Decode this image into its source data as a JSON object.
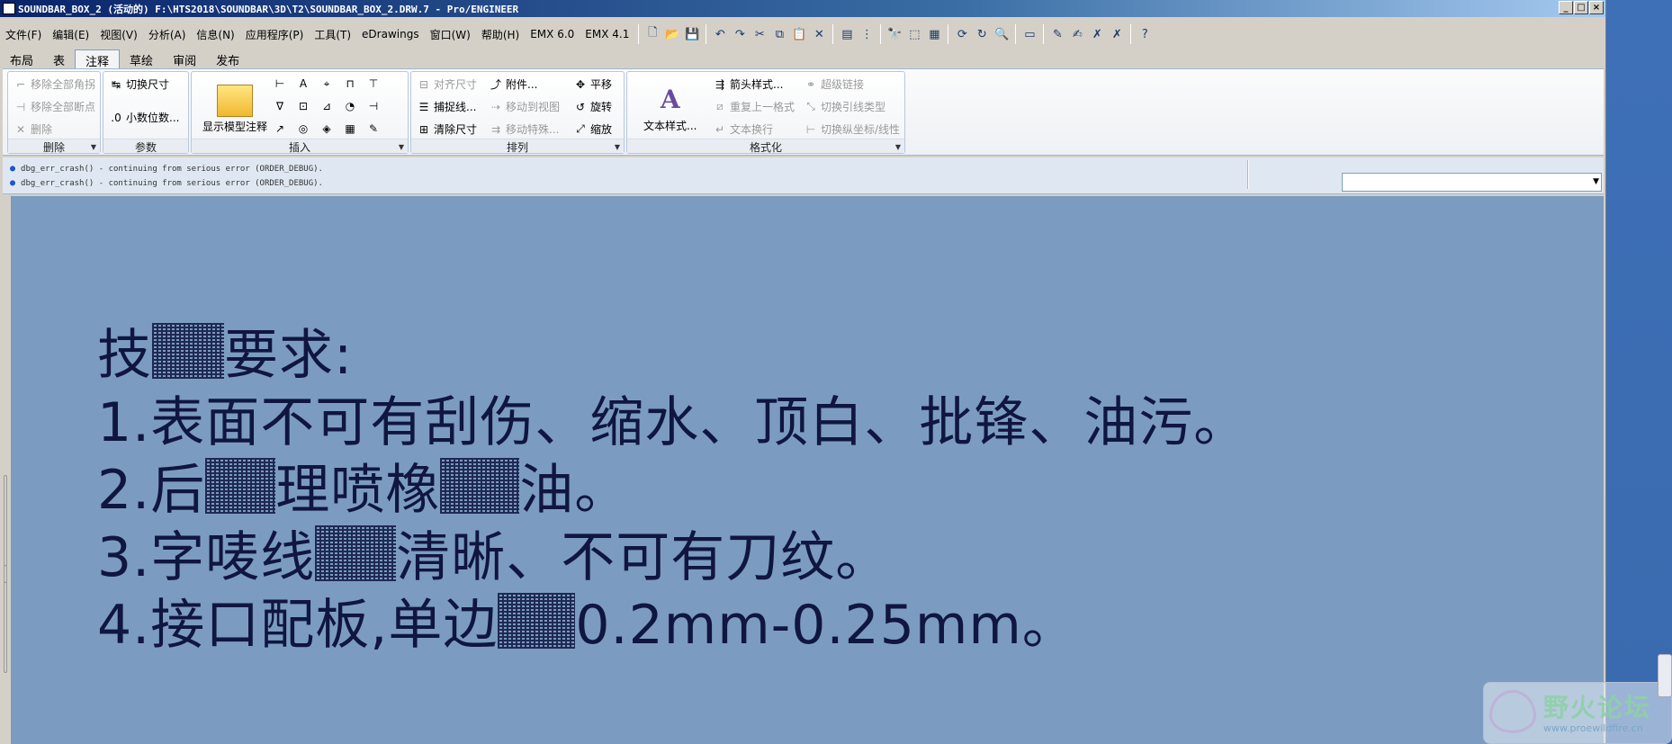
{
  "window": {
    "title": "SOUNDBAR_BOX_2 (活动的) F:\\HTS2018\\SOUNDBAR\\3D\\T2\\SOUNDBAR_BOX_2.DRW.7 - Pro/ENGINEER",
    "min_glyph": "_",
    "max_glyph": "□",
    "close_glyph": "×"
  },
  "menubar": {
    "items": [
      "文件(F)",
      "编辑(E)",
      "视图(V)",
      "分析(A)",
      "信息(N)",
      "应用程序(P)",
      "工具(T)",
      "eDrawings",
      "窗口(W)",
      "帮助(H)",
      "EMX 6.0",
      "EMX 4.1"
    ]
  },
  "toolbar_icons": {
    "new": "🗋",
    "open": "📂",
    "save": "💾",
    "undo": "↶",
    "redo": "↷",
    "cut": "✂",
    "copy": "⧉",
    "paste": "📋",
    "delete": "✕",
    "layer": "▤",
    "tree": "⋮",
    "find": "🔭",
    "select": "⬚",
    "props": "▦",
    "regen": "⟳",
    "repaint": "↻",
    "zoom": "🔍",
    "view": "▭",
    "t1": "✎",
    "t2": "✍",
    "t3": "✗",
    "t4": "✗",
    "help": "?"
  },
  "tabs": [
    "布局",
    "表",
    "注释",
    "草绘",
    "审阅",
    "发布"
  ],
  "active_tab": "注释",
  "ribbon": {
    "delete_group": {
      "label": "删除",
      "items": [
        "移除全部角拐",
        "移除全部断点",
        "删除"
      ]
    },
    "params_group": {
      "label": "参数",
      "items": [
        "切换尺寸",
        "小数位数..."
      ]
    },
    "insert_group": {
      "label": "插入",
      "show_annotation": "显示模型注释"
    },
    "arrange_group": {
      "label": "排列",
      "items": [
        "对齐尺寸",
        "附件...",
        "平移",
        "捕捉线...",
        "移动到视图",
        "旋转",
        "清除尺寸",
        "移动特殊...",
        "缩放"
      ]
    },
    "format_group": {
      "label": "格式化",
      "text_style": "文本样式...",
      "items": [
        "箭头样式...",
        "超级链接",
        "重复上一格式",
        "切换引线类型",
        "文本换行",
        "切换纵坐标/线性"
      ]
    }
  },
  "messages": [
    "dbg_err_crash() - continuing from serious error (ORDER_DEBUG).",
    "dbg_err_crash() - continuing from serious error (ORDER_DEBUG)."
  ],
  "filter_value": "",
  "note": {
    "line0_a": "技",
    "line0_b": "要求:",
    "line1": "1.表面不可有刮伤、缩水、顶白、批锋、油污。",
    "line2_a": "2.后",
    "line2_b": "理喷橡",
    "line2_c": "油。",
    "line3_a": "3.字唛线",
    "line3_b": "清晰、不可有刀纹。",
    "line4_a": "4.接口配板,单边",
    "line4_b": "0.2mm-0.25mm。"
  },
  "watermark": {
    "title": "野火论坛",
    "url": "www.proewildfire.cn"
  }
}
